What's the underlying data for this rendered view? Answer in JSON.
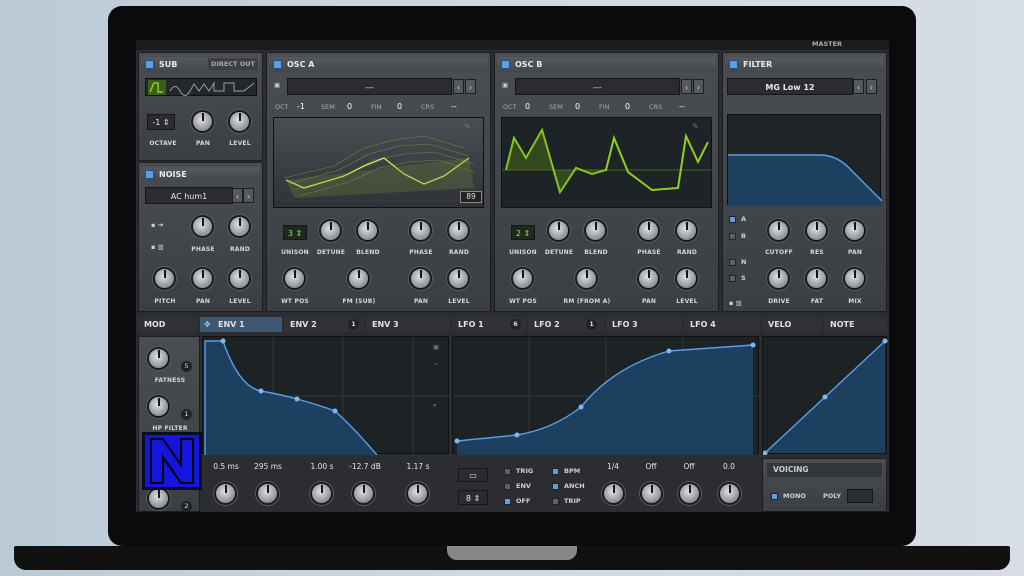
{
  "top": {
    "master": "MASTER"
  },
  "sub": {
    "title": "SUB",
    "direct_out": "DIRECT OUT",
    "octave_value": "-1",
    "labels": [
      "OCTAVE",
      "PAN",
      "LEVEL"
    ]
  },
  "noise": {
    "title": "NOISE",
    "preset": "AC hum1",
    "labels": [
      "PHASE",
      "RAND",
      "PITCH",
      "PAN",
      "LEVEL"
    ]
  },
  "osc_a": {
    "title": "OSC A",
    "wavetable": "---",
    "params": {
      "oct_l": "OCT",
      "oct": "-1",
      "sem_l": "SEM",
      "sem": "0",
      "fin_l": "FIN",
      "fin": "0",
      "crs_l": "CRS",
      "crs": "--"
    },
    "frame": "89",
    "unison": "3",
    "labels": [
      "UNISON",
      "DETUNE",
      "BLEND",
      "PHASE",
      "RAND",
      "WT POS",
      "FM (SUB)",
      "PAN",
      "LEVEL"
    ]
  },
  "osc_b": {
    "title": "OSC B",
    "wavetable": "---",
    "params": {
      "oct_l": "OCT",
      "oct": "0",
      "sem_l": "SEM",
      "sem": "0",
      "fin_l": "FIN",
      "fin": "0",
      "crs_l": "CRS",
      "crs": "--"
    },
    "unison": "2",
    "labels": [
      "UNISON",
      "DETUNE",
      "BLEND",
      "PHASE",
      "RAND",
      "WT POS",
      "RM (FROM A)",
      "PAN",
      "LEVEL"
    ]
  },
  "filter": {
    "title": "FILTER",
    "type": "MG Low 12",
    "routes": [
      "A",
      "B",
      "N",
      "S"
    ],
    "labels": [
      "CUTOFF",
      "RES",
      "PAN",
      "DRIVE",
      "FAT",
      "MIX"
    ]
  },
  "mod": {
    "tabs": {
      "mod": "MOD",
      "env1": "ENV 1",
      "env2": "ENV 2",
      "env2_count": "1",
      "env3": "ENV 3",
      "lfo1": "LFO 1",
      "lfo1_count": "6",
      "lfo2": "LFO 2",
      "lfo2_count": "1",
      "lfo3": "LFO 3",
      "lfo4": "LFO 4",
      "velo": "VELO",
      "note": "NOTE"
    },
    "side": {
      "fatness": "FATNESS",
      "fatness_count": "5",
      "hp_filter": "HP FILTER",
      "hp_count": "1",
      "third_count": "2"
    },
    "env_values": [
      "0.5 ms",
      "295 ms",
      "1.00 s",
      "-12.7 dB",
      "1.17 s"
    ],
    "lfo": {
      "grid": "8",
      "trig": "TRIG",
      "env": "ENV",
      "off": "OFF",
      "bpm": "BPM",
      "anch": "ANCH",
      "trip": "TRIP",
      "rate": "1/4",
      "v1": "Off",
      "v2": "Off",
      "v3": "0.0"
    },
    "voicing": {
      "title": "VOICING",
      "mono": "MONO",
      "poly": "POLY"
    }
  },
  "overlay": {
    "letter": "N"
  },
  "colors": {
    "accent": "#5aa0e8",
    "wave_green": "#8fd11e",
    "env_fill": "#1d3f60"
  }
}
